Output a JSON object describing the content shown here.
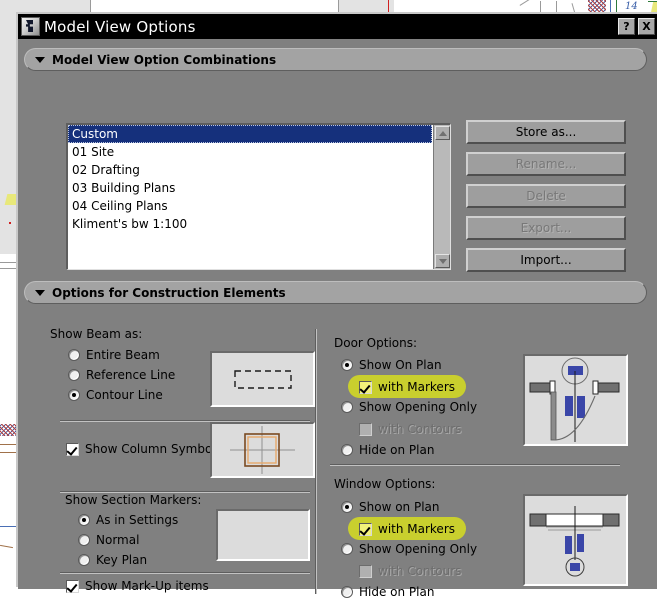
{
  "window": {
    "title": "Model View Options",
    "icon": "app-icon",
    "help_button": "?",
    "close_button": "X"
  },
  "sections": {
    "combinations": {
      "title": "Model View Option Combinations",
      "expanded_arrow": "▼"
    },
    "construction": {
      "title": "Options for Construction Elements",
      "expanded_arrow": "▼"
    }
  },
  "combination_list": {
    "items": [
      {
        "label": "Custom",
        "selected": true
      },
      {
        "label": "01 Site",
        "selected": false
      },
      {
        "label": "02 Drafting",
        "selected": false
      },
      {
        "label": "03 Building Plans",
        "selected": false
      },
      {
        "label": "04 Ceiling Plans",
        "selected": false
      },
      {
        "label": "Kliment's bw 1:100",
        "selected": false
      }
    ]
  },
  "combination_buttons": [
    {
      "label": "Store as...",
      "enabled": true
    },
    {
      "label": "Rename...",
      "enabled": false
    },
    {
      "label": "Delete",
      "enabled": false
    },
    {
      "label": "Export...",
      "enabled": false
    },
    {
      "label": "Import...",
      "enabled": true
    }
  ],
  "beam": {
    "group_label": "Show Beam as:",
    "options": [
      {
        "label": "Entire Beam",
        "selected": false
      },
      {
        "label": "Reference Line",
        "selected": false
      },
      {
        "label": "Contour Line",
        "selected": true
      }
    ]
  },
  "column": {
    "checkbox_label": "Show Column Symbol",
    "checked": true
  },
  "section_markers": {
    "group_label": "Show Section Markers:",
    "options": [
      {
        "label": "As in Settings",
        "selected": true
      },
      {
        "label": "Normal",
        "selected": false
      },
      {
        "label": "Key Plan",
        "selected": false
      }
    ]
  },
  "markup": {
    "checkbox_label": "Show Mark-Up items",
    "checked": true
  },
  "door_options": {
    "group_label": "Door Options:",
    "options": [
      {
        "label": "Show On Plan",
        "selected": true
      },
      {
        "label": "with Markers",
        "type": "checkbox",
        "checked": true,
        "highlighted": true,
        "indent": true
      },
      {
        "label": "Show Opening Only",
        "selected": false
      },
      {
        "label": "with Contours",
        "type": "checkbox",
        "checked": false,
        "disabled": true,
        "indent": true
      },
      {
        "label": "Hide on Plan",
        "selected": false
      }
    ]
  },
  "window_options": {
    "group_label": "Window Options:",
    "options": [
      {
        "label": "Show on Plan",
        "selected": true
      },
      {
        "label": "with Markers",
        "type": "checkbox",
        "checked": true,
        "highlighted": true,
        "indent": true
      },
      {
        "label": "Show Opening Only",
        "selected": false
      },
      {
        "label": "with Contours",
        "type": "checkbox",
        "checked": false,
        "disabled": true,
        "indent": true
      },
      {
        "label": "Hide on Plan",
        "selected": false
      }
    ]
  },
  "previews": {
    "beam": "dashed-rectangle-beam-contour",
    "column": "column-symbol-crosshair",
    "section_marker": "empty-preview",
    "door": "door-swing-plan-with-marker",
    "window": "window-plan-with-marker"
  },
  "colors": {
    "dialog_bg": "#808080",
    "titlebar_bg": "#000000",
    "titlebar_text": "#ffffff",
    "section_header_bg": "#a3a3a3",
    "selection_blue": "#15307c",
    "highlight_yellow": "#c9cf2e",
    "checkbox_yellow": "#f2f27a",
    "column_symbol_orange": "#c98a4b",
    "marker_blue": "#3a46a8"
  },
  "background": {
    "drawing_number": "14"
  }
}
